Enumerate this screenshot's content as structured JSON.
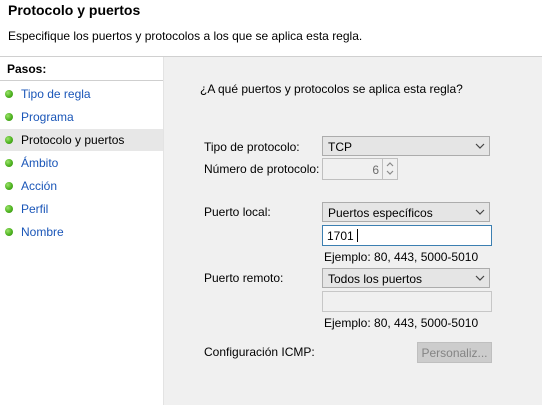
{
  "header": {
    "title": "Protocolo y puertos",
    "subtitle": "Especifique los puertos y protocolos a los que se aplica esta regla."
  },
  "sidebar": {
    "header": "Pasos:",
    "items": [
      {
        "label": "Tipo de regla"
      },
      {
        "label": "Programa"
      },
      {
        "label": "Protocolo y puertos",
        "current": true
      },
      {
        "label": "Ámbito"
      },
      {
        "label": "Acción"
      },
      {
        "label": "Perfil"
      },
      {
        "label": "Nombre"
      }
    ]
  },
  "form": {
    "question": "¿A qué puertos y protocolos se aplica esta regla?",
    "protocol_type": {
      "label": "Tipo de protocolo:",
      "value": "TCP"
    },
    "protocol_number": {
      "label": "Número de protocolo:",
      "value": "6"
    },
    "local_port": {
      "label": "Puerto local:",
      "option": "Puertos específicos",
      "value": "1701",
      "example": "Ejemplo: 80, 443, 5000-5010"
    },
    "remote_port": {
      "label": "Puerto remoto:",
      "option": "Todos los puertos",
      "value": "",
      "example": "Ejemplo: 80, 443, 5000-5010"
    },
    "icmp": {
      "label": "Configuración ICMP:",
      "button": "Personaliz..."
    }
  },
  "colors": {
    "link": "#1a56b8",
    "step_dot": "#4fb321",
    "panel_bg": "#f0f0f0",
    "focus_border": "#3c7fb1"
  },
  "icons": [
    "green-dot-icon",
    "chevron-down-icon",
    "spinner-up-icon",
    "spinner-down-icon"
  ]
}
